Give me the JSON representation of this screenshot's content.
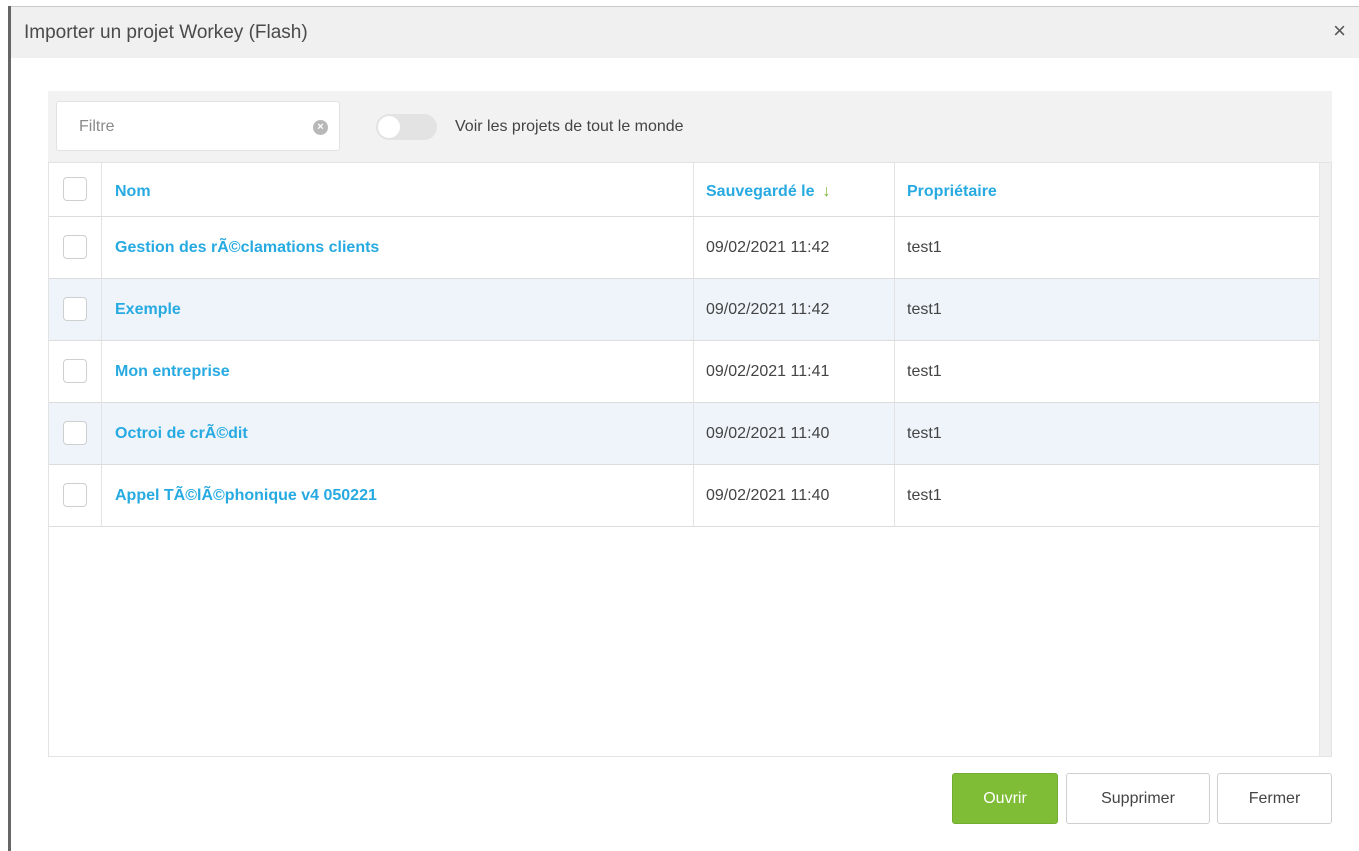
{
  "dialog": {
    "title": "Importer un projet Workey (Flash)",
    "close_symbol": "×"
  },
  "toolbar": {
    "filter_placeholder": "Filtre",
    "clear_symbol": "×",
    "toggle_label": "Voir les projets de tout le monde",
    "toggle_on": false
  },
  "table": {
    "headers": {
      "name": "Nom",
      "saved": "Sauvegardé le",
      "owner": "Propriétaire",
      "sort_arrow": "↓"
    },
    "rows": [
      {
        "name": "Gestion des rÃ©clamations clients",
        "saved": "09/02/2021 11:42",
        "owner": "test1"
      },
      {
        "name": "Exemple",
        "saved": "09/02/2021 11:42",
        "owner": "test1"
      },
      {
        "name": "Mon entreprise",
        "saved": "09/02/2021 11:41",
        "owner": "test1"
      },
      {
        "name": "Octroi de crÃ©dit",
        "saved": "09/02/2021 11:40",
        "owner": "test1"
      },
      {
        "name": "Appel TÃ©lÃ©phonique v4 050221",
        "saved": "09/02/2021 11:40",
        "owner": "test1"
      }
    ]
  },
  "buttons": {
    "open": "Ouvrir",
    "delete": "Supprimer",
    "close": "Fermer"
  },
  "colors": {
    "link": "#27aae1",
    "primary_button": "#7ebd35",
    "sort_arrow": "#7ab536",
    "alt_row": "#eef4fa"
  }
}
